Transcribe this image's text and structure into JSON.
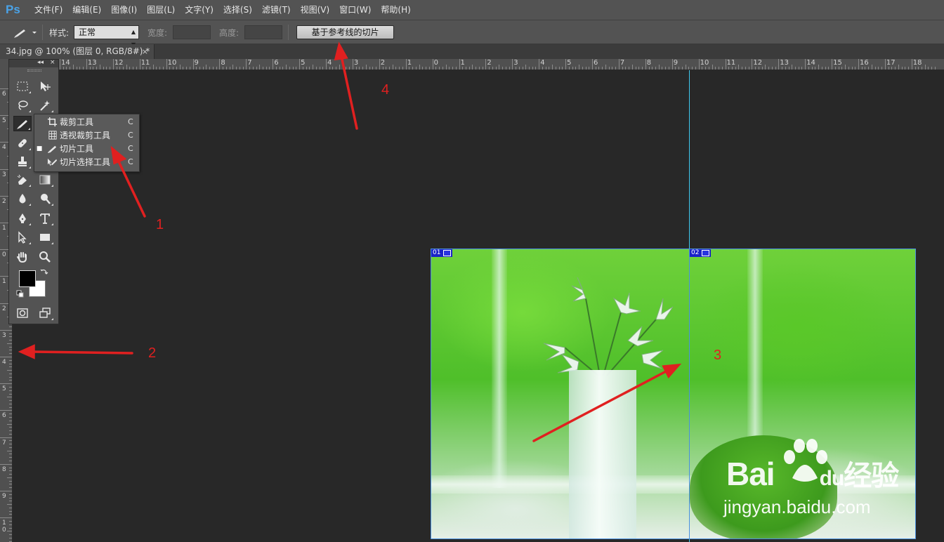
{
  "app": {
    "logo": "Ps"
  },
  "menu": [
    "文件(F)",
    "编辑(E)",
    "图像(I)",
    "图层(L)",
    "文字(Y)",
    "选择(S)",
    "滤镜(T)",
    "视图(V)",
    "窗口(W)",
    "帮助(H)"
  ],
  "options": {
    "style_label": "样式:",
    "style_value": "正常",
    "width_label": "宽度:",
    "height_label": "高度:",
    "slices_from_guides": "基于参考线的切片"
  },
  "document": {
    "tab_title": "34.jpg @ 100% (图层 0, RGB/8#) *",
    "close": "×"
  },
  "ruler": {
    "h_labels": [
      "14",
      "13",
      "12",
      "11",
      "10",
      "9",
      "8",
      "7",
      "6",
      "5",
      "4",
      "3",
      "2",
      "1",
      "0",
      "1",
      "2",
      "3",
      "4",
      "5",
      "6",
      "7",
      "8",
      "9",
      "10",
      "11",
      "12",
      "13",
      "14",
      "15",
      "16",
      "17",
      "18"
    ],
    "v_labels": [
      "6",
      "5",
      "4",
      "3",
      "2",
      "1",
      "0",
      "1",
      "2",
      "3",
      "4",
      "5",
      "6",
      "7",
      "8",
      "9",
      "1\n0"
    ]
  },
  "toolbox": {
    "collapse": "◂◂",
    "close": "×"
  },
  "flyout": {
    "items": [
      {
        "label": "裁剪工具",
        "key": "C",
        "selected": false,
        "icon": "crop-icon"
      },
      {
        "label": "透视裁剪工具",
        "key": "C",
        "selected": false,
        "icon": "perspective-crop-icon"
      },
      {
        "label": "切片工具",
        "key": "C",
        "selected": true,
        "icon": "slice-icon"
      },
      {
        "label": "切片选择工具",
        "key": "C",
        "selected": false,
        "icon": "slice-select-icon"
      }
    ],
    "bullet": "■"
  },
  "slices": [
    {
      "num": "01"
    },
    {
      "num": "02"
    }
  ],
  "watermark": {
    "brand": "Bai",
    "brand2": "du",
    "brand_cn": "经验",
    "url": "jingyan.baidu.com"
  },
  "annotations": [
    "1",
    "2",
    "3",
    "4"
  ],
  "colors": {
    "annotation": "#e02020",
    "guide": "#3ec9ee",
    "slice_tag": "#1a22c8",
    "menubar": "#535353",
    "canvas": "#282828"
  }
}
